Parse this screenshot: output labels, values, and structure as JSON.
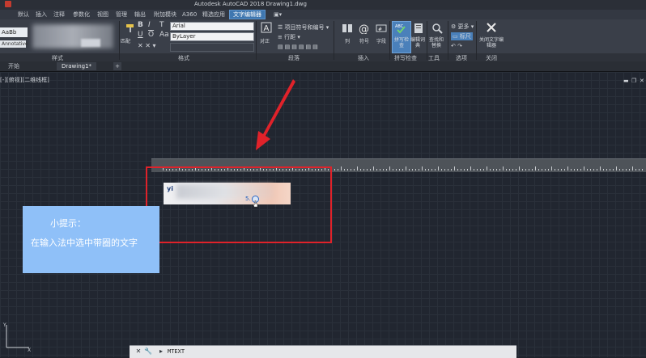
{
  "window": {
    "title": "Autodesk AutoCAD 2018   Drawing1.dwg"
  },
  "menu_tabs": [
    "默认",
    "插入",
    "注释",
    "参数化",
    "视图",
    "管理",
    "输出",
    "附加模块",
    "A360",
    "精选应用",
    "文字编辑器"
  ],
  "active_tab": "文字编辑器",
  "ribbon": {
    "style_samples": [
      "AaBb",
      "Annotative"
    ],
    "style_panel_label": "样式",
    "format": {
      "font": "Arial",
      "color": "ByLayer",
      "bold": "B",
      "italic": "I",
      "underline": "U",
      "overline": "O",
      "match_label": "匹配",
      "panel_label": "格式"
    },
    "paragraph": {
      "justify_label": "对正",
      "bullets_label": "项目符号和编号",
      "line_spacing_label": "行距",
      "panel_label": "段落"
    },
    "insert": {
      "column_label": "列",
      "symbol_label": "符号",
      "field_label": "字段",
      "panel_label": "插入"
    },
    "spell": {
      "spellcheck_label": "拼写检查",
      "dict_label": "编辑词典",
      "panel_label": "拼写检查"
    },
    "tools": {
      "find_label": "查找和替换",
      "panel_label": "工具"
    },
    "options": {
      "more_label": "更多",
      "ruler_label": "标尺",
      "panel_label": "选项"
    },
    "close": {
      "close_label": "关闭文字编辑器",
      "panel_label": "关闭"
    }
  },
  "doc_tabs": [
    "开始",
    "Drawing1*"
  ],
  "viewport_label": "[-][俯视][二维线框]",
  "editor": {
    "typed_text": "yi",
    "candidate_number": "5."
  },
  "tip": {
    "title": "小提示：",
    "body": "在输入法中选中带圈的文字"
  },
  "command_line": {
    "text": "MTEXT"
  },
  "colors": {
    "highlight_rect": "#e0222a",
    "tip_background": "#8fc0f8",
    "accent": "#3f77b0"
  }
}
